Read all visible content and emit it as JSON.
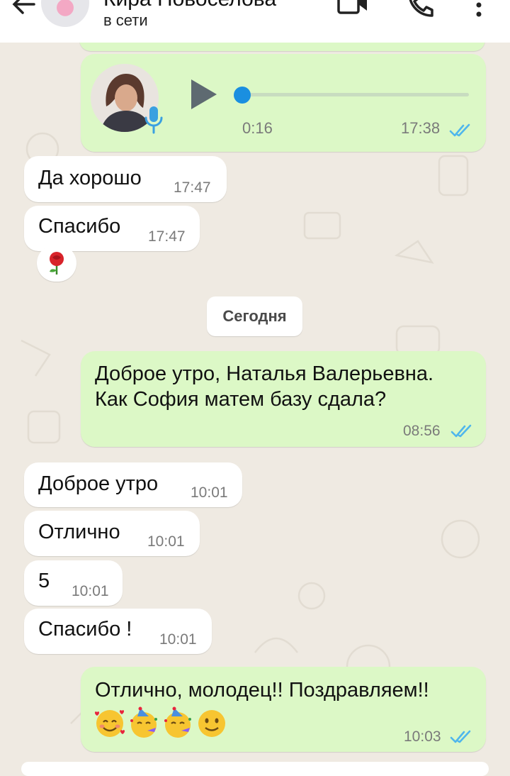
{
  "header": {
    "contact_name": "Кира Новоселова",
    "status": "в сети"
  },
  "voice_message": {
    "duration": "0:16",
    "time": "17:38",
    "progress": 0
  },
  "messages": [
    {
      "text": "Да хорошо",
      "time": "17:47"
    },
    {
      "text": "Спасибо",
      "time": "17:47"
    },
    {
      "reaction": "rose"
    },
    {
      "date_separator": "Сегодня"
    },
    {
      "line1": "Доброе утро, Наталья Валерьевна.",
      "line2": "Как София матем базу сдала?",
      "time": "08:56"
    },
    {
      "text": "Доброе утро",
      "time": "10:01"
    },
    {
      "text": "Отлично",
      "time": "10:01"
    },
    {
      "text": "5",
      "time": "10:01"
    },
    {
      "text": "Спасибо !",
      "time": "10:01"
    },
    {
      "text": "Отлично, молодец!! Поздравляем!!",
      "emojis": [
        "smiling-face-with-hearts",
        "partying-face",
        "partying-face",
        "slightly-smiling-face"
      ],
      "time": "10:03"
    }
  ],
  "colors": {
    "incoming_bubble": "#ffffff",
    "outgoing_bubble": "#dcf8c6",
    "chat_background": "#efeae2",
    "read_ticks": "#4fb6ec"
  }
}
